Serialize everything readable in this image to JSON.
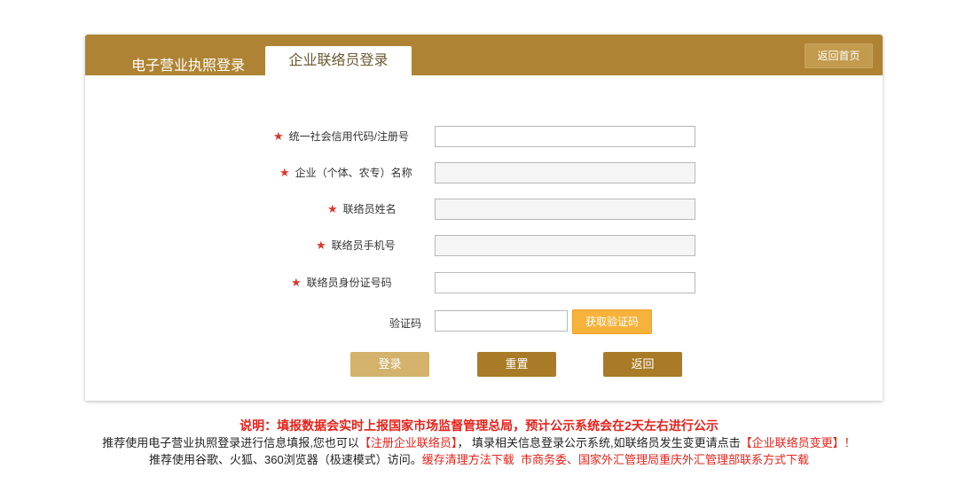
{
  "header": {
    "tab_license": "电子营业执照登录",
    "tab_liaison": "企业联络员登录",
    "home_button": "返回首页"
  },
  "form": {
    "fields": [
      {
        "label": "统一社会信用代码/注册号",
        "required": true,
        "value": ""
      },
      {
        "label": "企业（个体、农专）名称",
        "required": true,
        "value": ""
      },
      {
        "label": "联络员姓名",
        "required": true,
        "value": ""
      },
      {
        "label": "联络员手机号",
        "required": true,
        "value": ""
      },
      {
        "label": "联络员身份证号码",
        "required": true,
        "value": ""
      }
    ],
    "star": "★",
    "captcha_label": "验证码",
    "captcha_value": "",
    "get_code_button": "获取验证码",
    "login_button": "登录",
    "reset_button": "重置",
    "back_button": "返回"
  },
  "notes": {
    "line1": "说明：填报数据会实时上报国家市场监督管理总局，预计公示系统会在2天左右进行公示",
    "line2_a": "推荐使用电子营业执照登录进行信息填报,您也可以",
    "line2_link1": "【注册企业联络员】",
    "line2_b": "，  填录相关信息登录公示系统,如联络员发生变更请点击",
    "line2_link2": "【企业联络员变更】！",
    "line3_a": "推荐使用谷歌、火狐、360浏览器（极速模式）访问。",
    "line3_link1": "缓存清理方法下载",
    "line3_link2": "市商务委、国家外汇管理局重庆外汇管理部联系方式下载"
  },
  "colors": {
    "brand": "#ae8434",
    "required": "#d9362a",
    "accent_button": "#f6b23a",
    "note_red": "#e5231b"
  }
}
